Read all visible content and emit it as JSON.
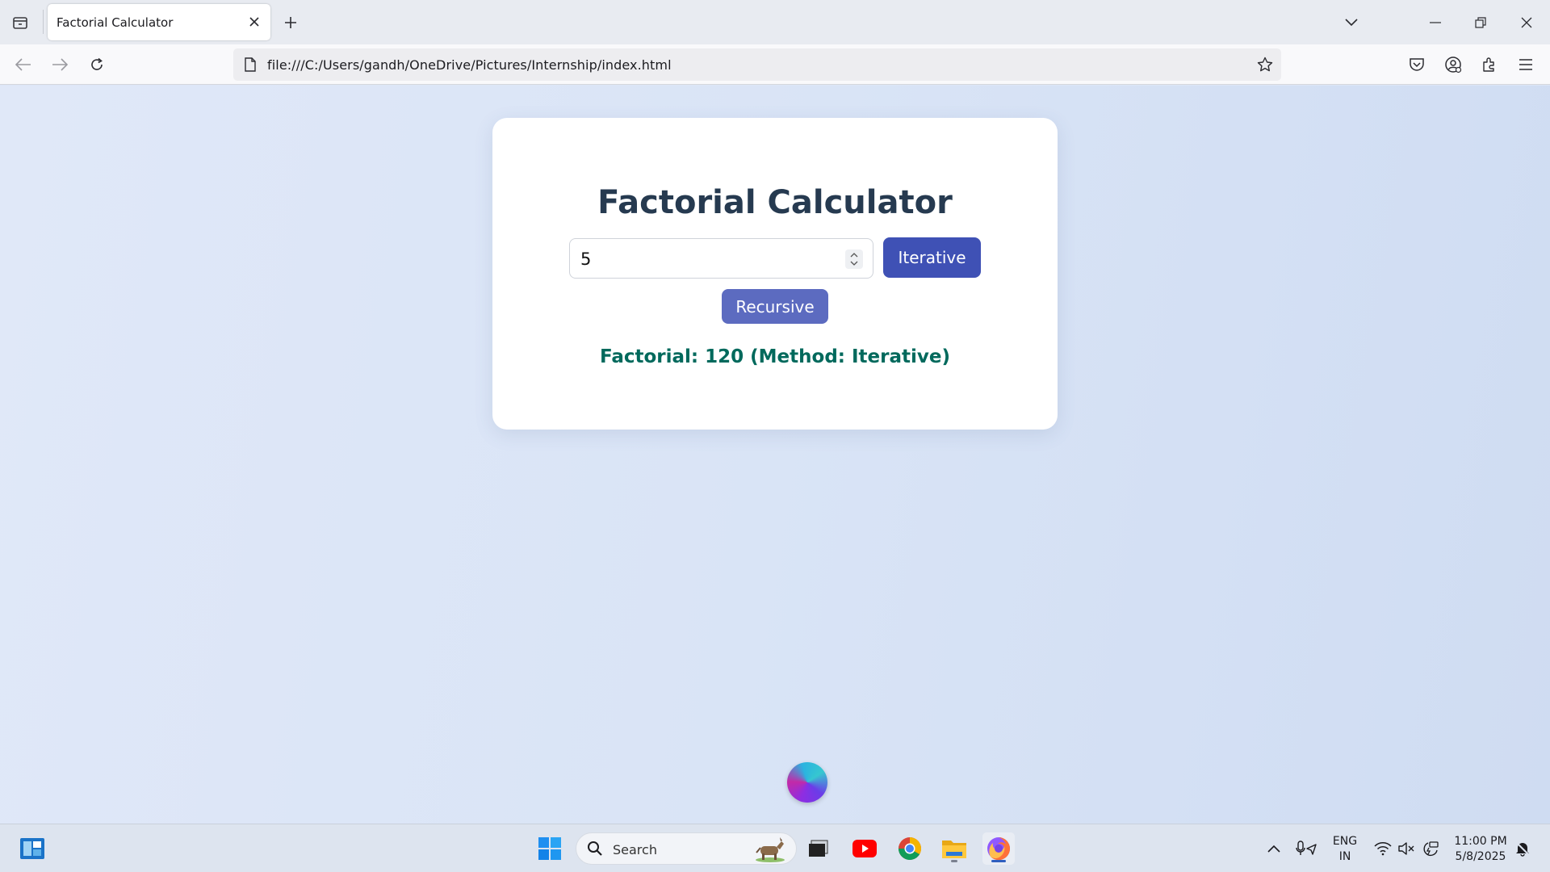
{
  "browser": {
    "tab": {
      "title": "Factorial Calculator"
    },
    "address_bar": {
      "url": "file:///C:/Users/gandh/OneDrive/Pictures/Internship/index.html"
    }
  },
  "page": {
    "title": "Factorial Calculator",
    "number_input": {
      "value": "5"
    },
    "buttons": {
      "iterative": "Iterative",
      "recursive": "Recursive"
    },
    "result": "Factorial: 120 (Method: Iterative)"
  },
  "taskbar": {
    "search_label": "Search",
    "language": {
      "line1": "ENG",
      "line2": "IN"
    },
    "clock": {
      "time": "11:00 PM",
      "date": "5/8/2025"
    }
  },
  "colors": {
    "primary_button": "#3f51b5",
    "secondary_button": "#5c6bc0",
    "result_text": "#00695c",
    "title_text": "#263a50"
  }
}
